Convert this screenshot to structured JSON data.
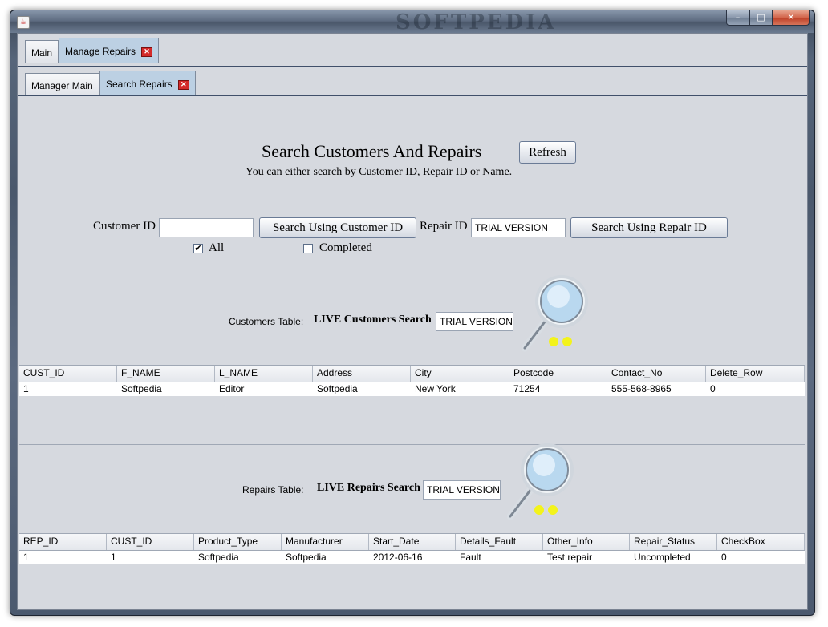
{
  "window": {
    "titlebar_watermark": "SOFTPEDIA",
    "buttons": [
      "–",
      "□",
      "✕"
    ]
  },
  "outer_tabs": [
    {
      "label": "Main",
      "active": false
    },
    {
      "label": "Manage Repairs",
      "active": true
    }
  ],
  "inner_tabs": [
    {
      "label": "Manager Main",
      "active": false
    },
    {
      "label": "Search Repairs",
      "active": true
    }
  ],
  "search": {
    "title": "Search Customers And Repairs",
    "refresh_label": "Refresh",
    "subtitle": "You can either search by Customer ID, Repair ID or Name.",
    "customer_id_label": "Customer ID",
    "customer_id_value": "",
    "search_customer_button": "Search Using Customer ID",
    "repair_id_label": "Repair ID",
    "repair_id_value": "TRIAL VERSION",
    "search_repair_button": "Search Using Repair ID",
    "all_label": "All",
    "all_checked": true,
    "completed_label": "Completed",
    "completed_checked": false
  },
  "customers": {
    "table_label": "Customers Table:",
    "live_label": "LIVE Customers Search",
    "live_value": "TRIAL VERSION",
    "columns": [
      "CUST_ID",
      "F_NAME",
      "L_NAME",
      "Address",
      "City",
      "Postcode",
      "Contact_No",
      "Delete_Row"
    ],
    "rows": [
      [
        "1",
        "Softpedia",
        "Editor",
        "Softpedia",
        "New York",
        "71254",
        "555-568-8965",
        "0"
      ]
    ]
  },
  "repairs": {
    "table_label": "Repairs Table:",
    "live_label": "LIVE Repairs Search",
    "live_value": "TRIAL VERSION",
    "columns": [
      "REP_ID",
      "CUST_ID",
      "Product_Type",
      "Manufacturer",
      "Start_Date",
      "Details_Fault",
      "Other_Info",
      "Repair_Status",
      "CheckBox"
    ],
    "rows": [
      [
        "1",
        "1",
        "Softpedia",
        "Softpedia",
        "2012-06-16",
        "Fault",
        "Test repair",
        "Uncompleted",
        "0"
      ]
    ]
  }
}
